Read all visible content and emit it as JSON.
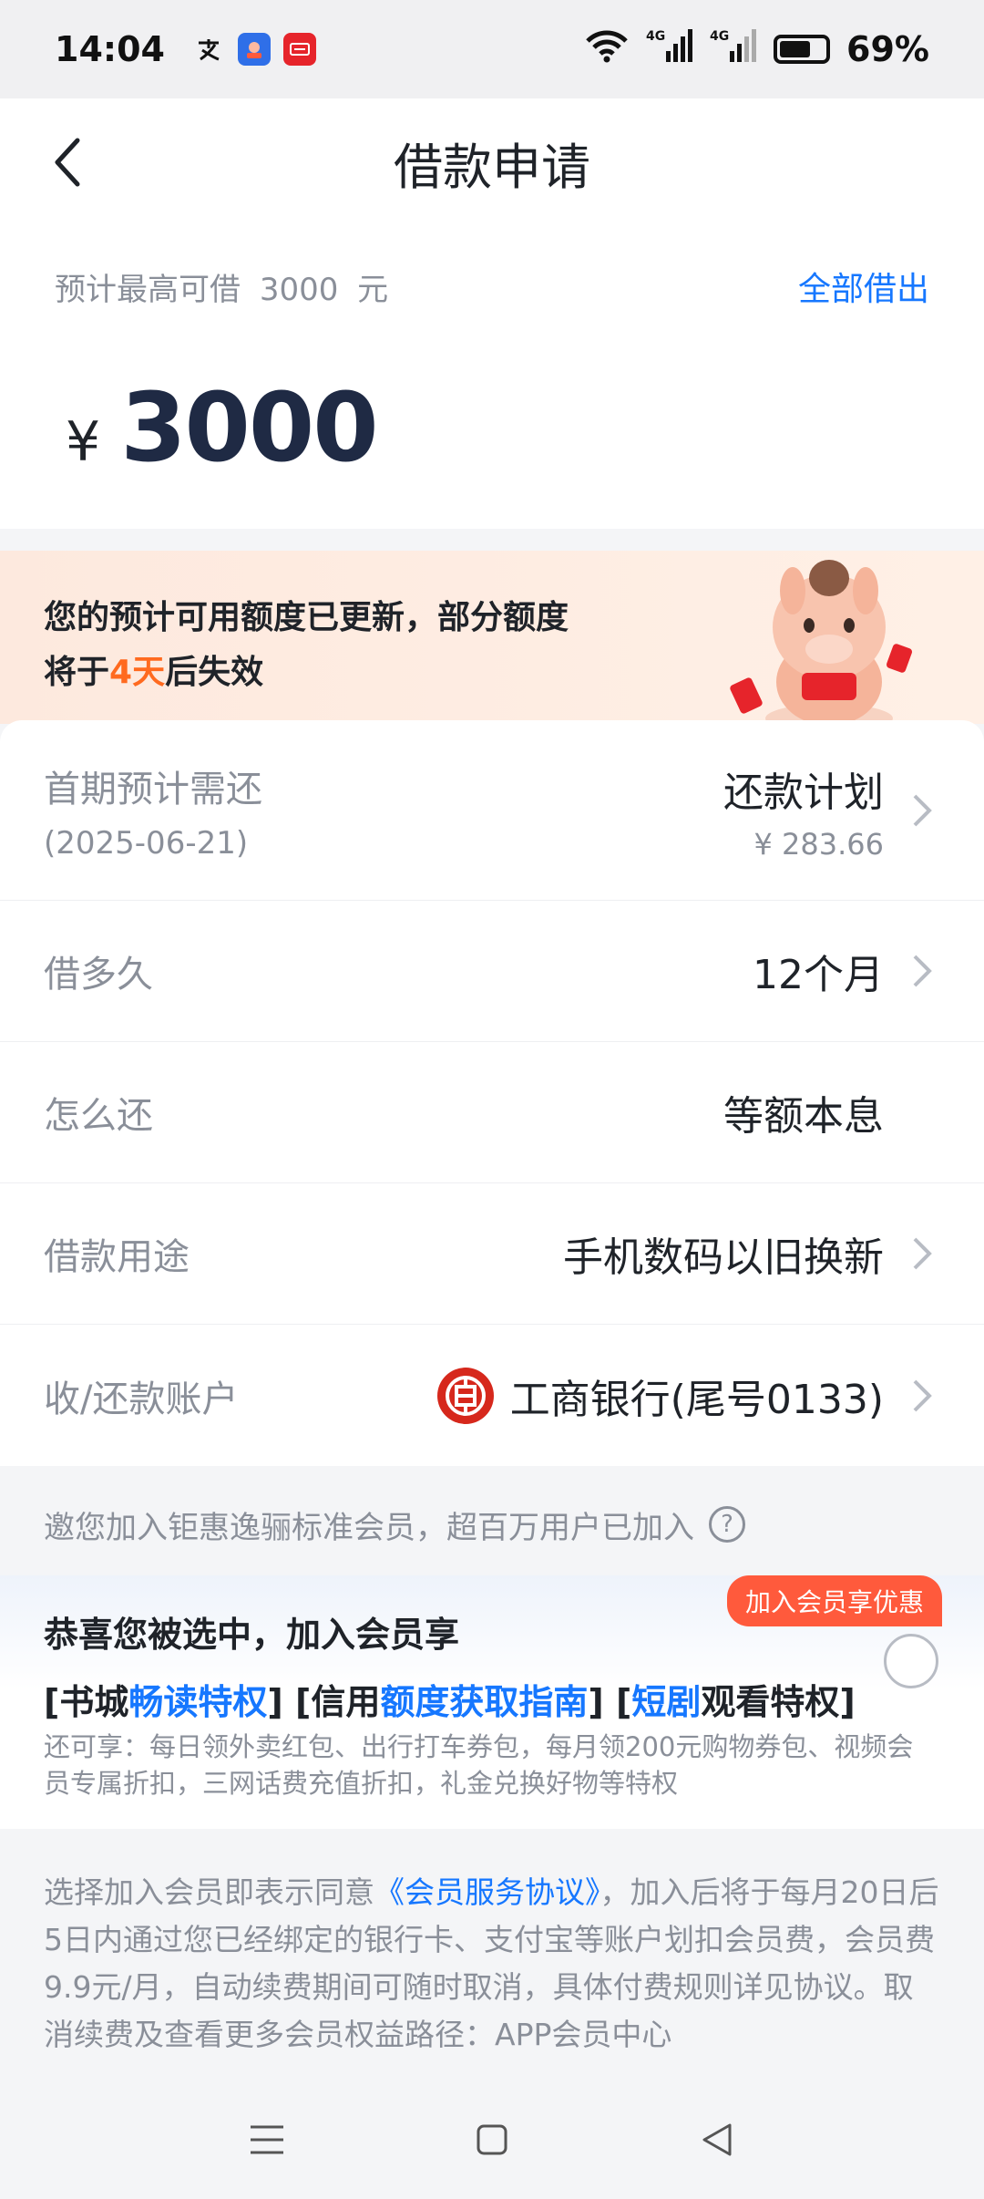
{
  "status": {
    "time": "14:04",
    "battery": "69%",
    "battery_level": 0.69,
    "signal_1": "4G",
    "signal_2": "4G"
  },
  "header": {
    "title": "借款申请"
  },
  "loan": {
    "limit_prefix": "预计最高可借",
    "limit_amount": "3000",
    "limit_unit": "元",
    "borrow_all": "全部借出",
    "currency": "¥",
    "amount": "3000"
  },
  "notice": {
    "line1": "您的预计可用额度已更新，部分额度",
    "line2_prefix": "将于",
    "line2_highlight": "4天",
    "line2_suffix": "后失效"
  },
  "details": {
    "first_payment_label": "首期预计需还",
    "first_payment_date": "(2025-06-21)",
    "repayment_plan": "还款计划",
    "first_payment_amount": "¥ 283.66",
    "term_label": "借多久",
    "term_value": "12个月",
    "method_label": "怎么还",
    "method_value": "等额本息",
    "purpose_label": "借款用途",
    "purpose_value": "手机数码以旧换新",
    "account_label": "收/还款账户",
    "account_value": "工商银行(尾号0133)"
  },
  "membership": {
    "invite_text": "邀您加入钜惠逸骊标准会员，超百万用户已加入",
    "badge": "加入会员享优惠",
    "title": "恭喜您被选中，加入会员享",
    "perk1_open": "[书城",
    "perk1_blue": "畅读特权",
    "perk2_open": "] [信用",
    "perk2_blue": "额度获取指南",
    "perk3_open": "] [",
    "perk3_blue": "短剧",
    "perk3_close": "观看特权]",
    "extra": "还可享：每日领外卖红包、出行打车券包，每月领200元购物券包、视频会员专属折扣，三网话费充值折扣，礼金兑换好物等特权"
  },
  "agreement": {
    "prefix": "选择加入会员即表示同意",
    "link": "《会员服务协议》",
    "suffix": "，加入后将于每月20日后5日内通过您已经绑定的银行卡、支付宝等账户划扣会员费，会员费9.9元/月，自动续费期间可随时取消，具体付费规则详见协议。取消续费及查看更多会员权益路径：APP会员中心"
  }
}
